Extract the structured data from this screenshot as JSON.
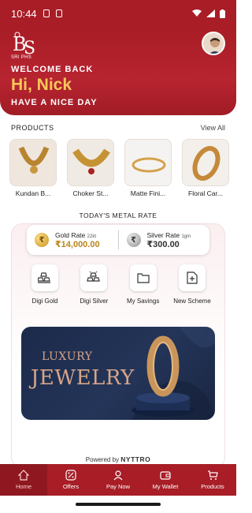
{
  "status": {
    "time": "10:44"
  },
  "header": {
    "logo_caption": "SRI PHS",
    "welcome": "WELCOME BACK",
    "greeting": "Hi, Nick",
    "subgreeting": "HAVE A NICE DAY"
  },
  "products": {
    "title": "PRODUCTS",
    "view_all": "View All",
    "items": [
      {
        "name": "Kundan B..."
      },
      {
        "name": "Choker St..."
      },
      {
        "name": "Matte Fini..."
      },
      {
        "name": "Floral Car..."
      }
    ]
  },
  "metal_rate": {
    "title": "TODAY'S METAL RATE",
    "gold": {
      "label": "Gold Rate",
      "karat": "22kt",
      "value": "₹14,000.00"
    },
    "silver": {
      "label": "Silver Rate",
      "unit": "1gm",
      "value": "₹300.00"
    }
  },
  "quick_actions": [
    {
      "label": "Digi Gold",
      "icon": "gold-bars-icon"
    },
    {
      "label": "Digi Silver",
      "icon": "silver-bars-icon"
    },
    {
      "label": "My Savings",
      "icon": "folder-icon"
    },
    {
      "label": "New Scheme",
      "icon": "new-document-icon"
    }
  ],
  "banner": {
    "line1": "LUXURY",
    "line2": "JEWELRY"
  },
  "footer": {
    "powered_by": "Powered by",
    "brand": "NYTTRO"
  },
  "tabs": [
    {
      "label": "Home",
      "icon": "home-icon",
      "active": true
    },
    {
      "label": "Offers",
      "icon": "percent-icon"
    },
    {
      "label": "Pay Now",
      "icon": "pay-icon"
    },
    {
      "label": "My Wallet",
      "icon": "wallet-icon"
    },
    {
      "label": "Products",
      "icon": "cart-icon"
    }
  ],
  "colors": {
    "primary": "#a81d26",
    "gold": "#b7851b",
    "greeting": "#f7c85a"
  }
}
